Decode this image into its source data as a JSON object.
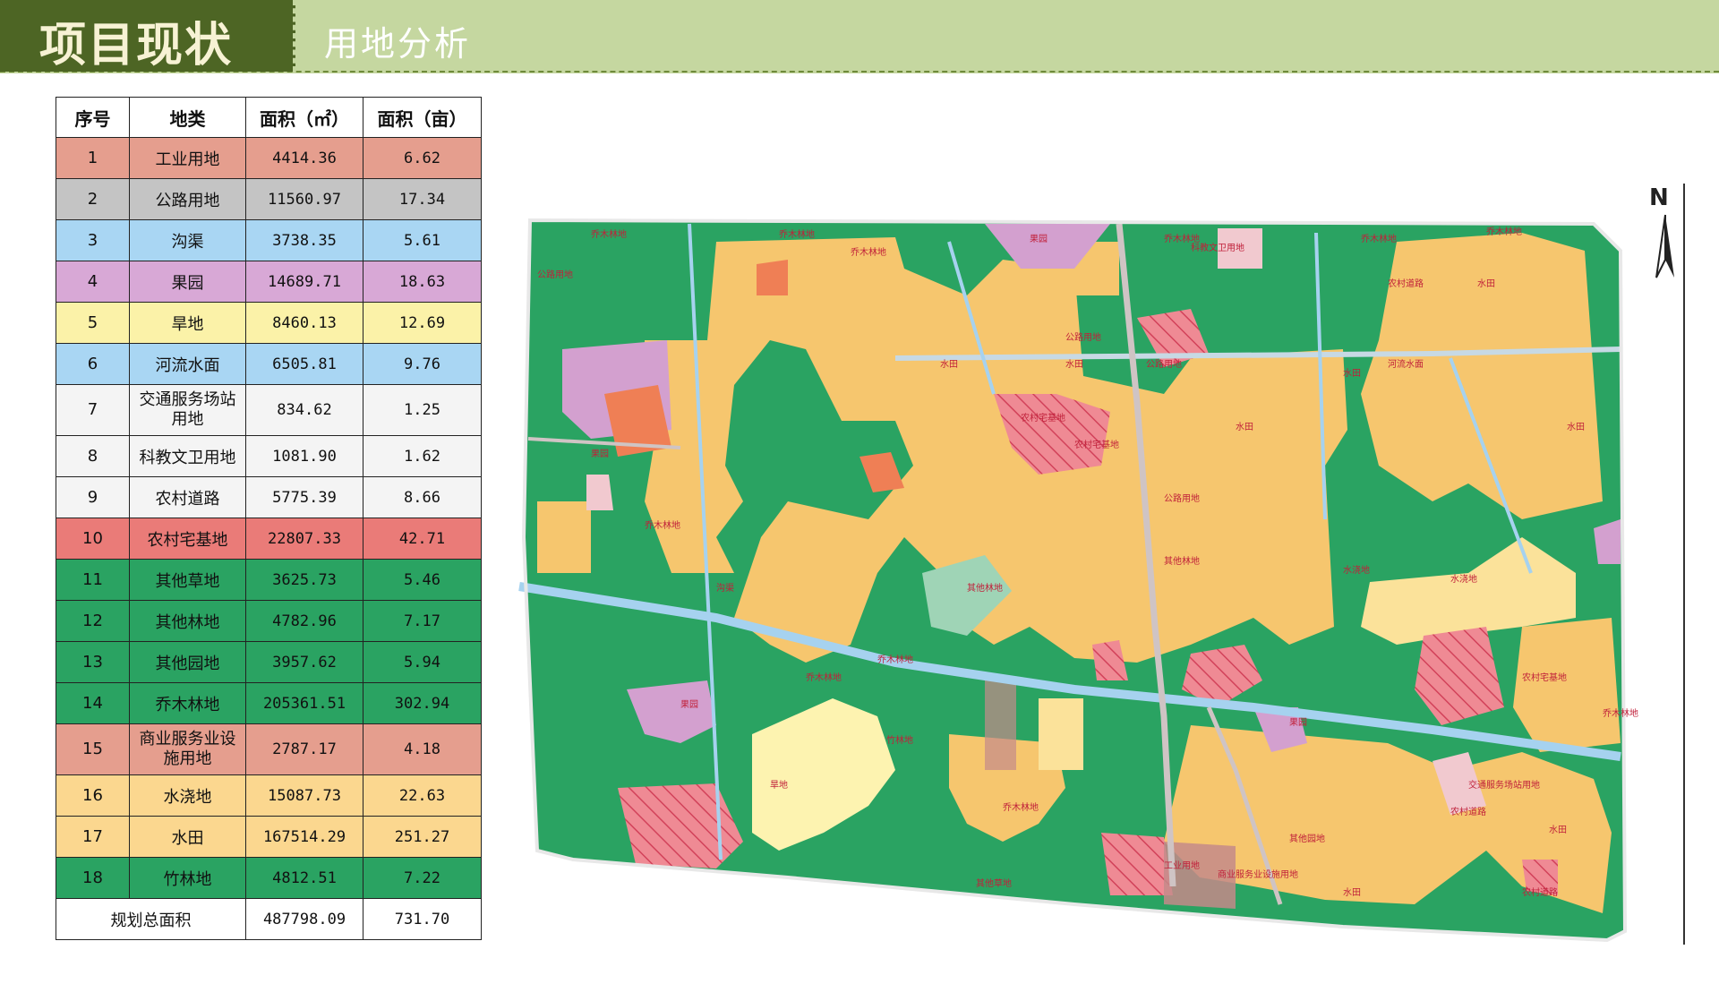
{
  "header": {
    "title": "项目现状",
    "subtitle": "用地分析"
  },
  "table": {
    "columns": [
      "序号",
      "地类",
      "面积（㎡）",
      "面积（亩）"
    ],
    "rows": [
      {
        "no": "1",
        "type": "工业用地",
        "area_m2": "4414.36",
        "area_mu": "6.62",
        "color": "#e59e8e"
      },
      {
        "no": "2",
        "type": "公路用地",
        "area_m2": "11560.97",
        "area_mu": "17.34",
        "color": "#c4c4c4"
      },
      {
        "no": "3",
        "type": "沟渠",
        "area_m2": "3738.35",
        "area_mu": "5.61",
        "color": "#a9d6f3"
      },
      {
        "no": "4",
        "type": "果园",
        "area_m2": "14689.71",
        "area_mu": "18.63",
        "color": "#d8a8d6"
      },
      {
        "no": "5",
        "type": "旱地",
        "area_m2": "8460.13",
        "area_mu": "12.69",
        "color": "#fbf2a8"
      },
      {
        "no": "6",
        "type": "河流水面",
        "area_m2": "6505.81",
        "area_mu": "9.76",
        "color": "#a9d6f3"
      },
      {
        "no": "7",
        "type": "交通服务场站用地",
        "area_m2": "834.62",
        "area_mu": "1.25",
        "color": "#f4f4f4"
      },
      {
        "no": "8",
        "type": "科教文卫用地",
        "area_m2": "1081.90",
        "area_mu": "1.62",
        "color": "#f4f4f4"
      },
      {
        "no": "9",
        "type": "农村道路",
        "area_m2": "5775.39",
        "area_mu": "8.66",
        "color": "#f4f4f4"
      },
      {
        "no": "10",
        "type": "农村宅基地",
        "area_m2": "22807.33",
        "area_mu": "42.71",
        "color": "#ea7b78"
      },
      {
        "no": "11",
        "type": "其他草地",
        "area_m2": "3625.73",
        "area_mu": "5.46",
        "color": "#2aa362"
      },
      {
        "no": "12",
        "type": "其他林地",
        "area_m2": "4782.96",
        "area_mu": "7.17",
        "color": "#2aa362"
      },
      {
        "no": "13",
        "type": "其他园地",
        "area_m2": "3957.62",
        "area_mu": "5.94",
        "color": "#2aa362"
      },
      {
        "no": "14",
        "type": "乔木林地",
        "area_m2": "205361.51",
        "area_mu": "302.94",
        "color": "#2aa362"
      },
      {
        "no": "15",
        "type": "商业服务业设施用地",
        "area_m2": "2787.17",
        "area_mu": "4.18",
        "color": "#e59e8e"
      },
      {
        "no": "16",
        "type": "水浇地",
        "area_m2": "15087.73",
        "area_mu": "22.63",
        "color": "#fbd78f"
      },
      {
        "no": "17",
        "type": "水田",
        "area_m2": "167514.29",
        "area_mu": "251.27",
        "color": "#fbd78f"
      },
      {
        "no": "18",
        "type": "竹林地",
        "area_m2": "4812.51",
        "area_mu": "7.22",
        "color": "#2aa362"
      }
    ],
    "total": {
      "label": "规划总面积",
      "area_m2": "487798.09",
      "area_mu": "731.70"
    }
  },
  "map": {
    "north_label": "N",
    "labels": [
      "乔木林地",
      "水田",
      "果园",
      "农村道路",
      "公路用地",
      "农村宅基地",
      "其他林地",
      "水浇地",
      "沟渠",
      "河流水面",
      "旱地",
      "科教文卫用地",
      "工业用地",
      "商业服务业设施用地",
      "交通服务场站用地",
      "竹林地",
      "其他草地",
      "其他园地"
    ],
    "colors": {
      "forest": "#2aa362",
      "paddy": "#f6c66e",
      "irrigated": "#fbe29a",
      "dryland": "#fdf3b0",
      "orchard": "#d3a0cf",
      "homestead": "#e57d86",
      "industrial": "#ef7f55",
      "road": "#d0c6c4",
      "water": "#a6d2ef",
      "grassland": "#9fd4b6",
      "commercial": "#c48a8a"
    }
  }
}
